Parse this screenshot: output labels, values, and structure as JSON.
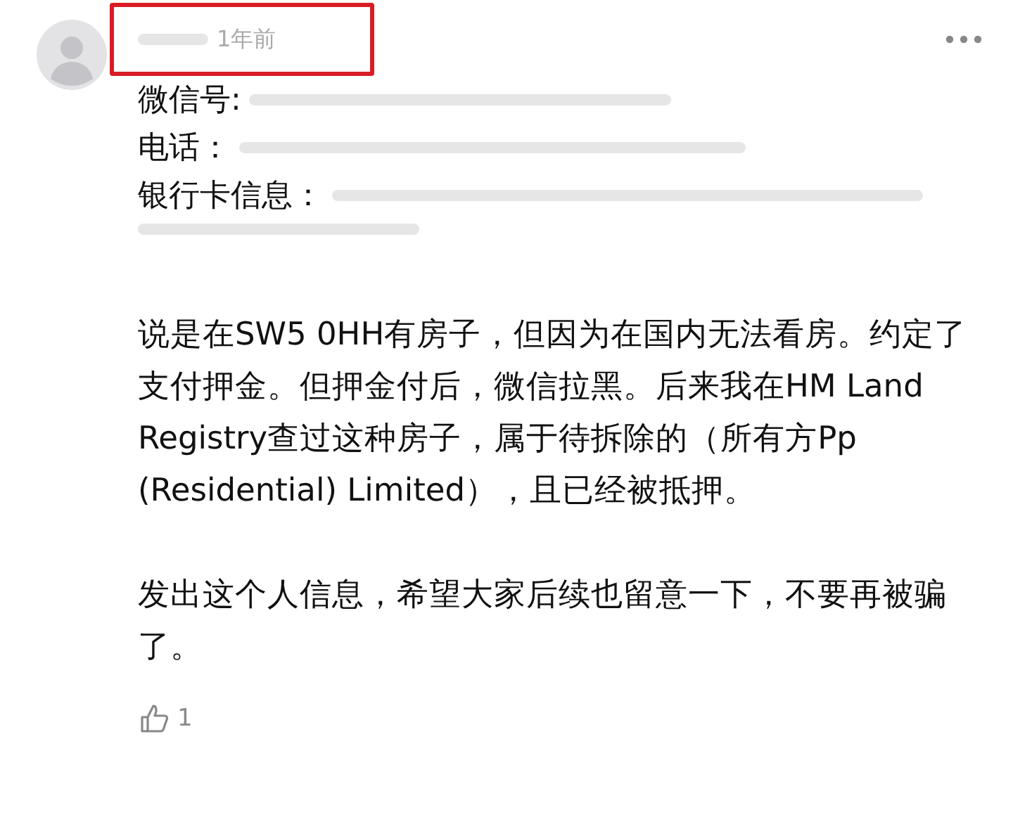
{
  "comment": {
    "time": "1年前",
    "highlighted": true,
    "info_lines": [
      {
        "kind": "labeled",
        "label": "微信号:"
      },
      {
        "kind": "labeled",
        "label": "电话："
      },
      {
        "kind": "labeled",
        "label": "银行卡信息："
      },
      {
        "kind": "redacted"
      }
    ],
    "paragraphs": [
      "说是在SW5 0HH有房子，但因为在国内无法看房。约定了支付押金。但押金付后，微信拉黑。后来我在HM Land Registry查过这种房子，属于待拆除的（所有方Pp (Residential) Limited），且已经被抵押。",
      "发出这个人信息，希望大家后续也留意一下，不要再被骗了。"
    ],
    "likes": "1"
  }
}
